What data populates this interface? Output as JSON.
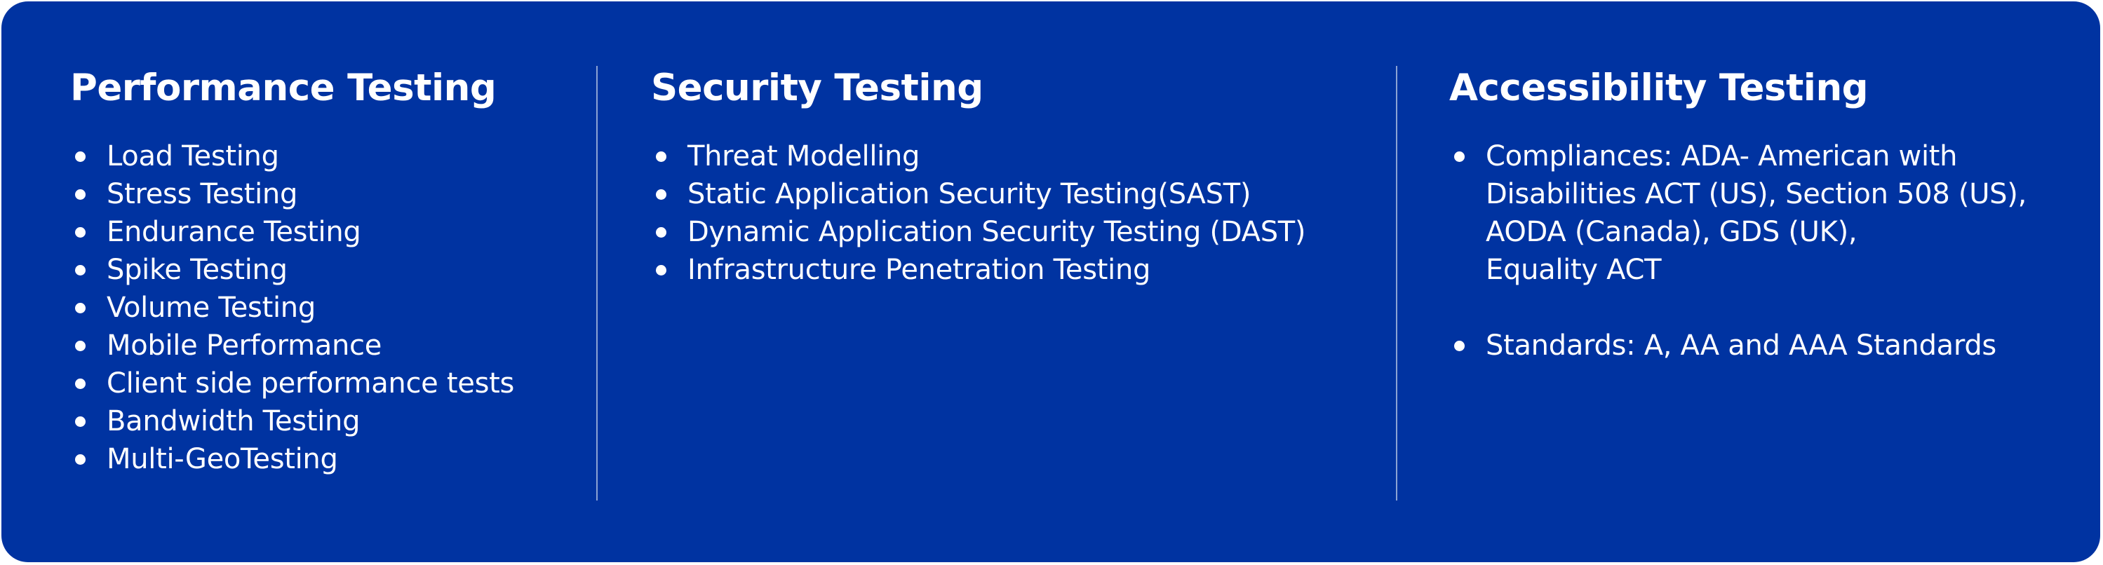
{
  "columns": [
    {
      "title": "Performance Testing",
      "items": [
        "Load Testing",
        "Stress Testing",
        "Endurance Testing",
        "Spike Testing",
        "Volume Testing",
        "Mobile Performance",
        "Client side performance tests",
        "Bandwidth Testing",
        "Multi-GeoTesting"
      ]
    },
    {
      "title": "Security Testing",
      "items": [
        "Threat Modelling",
        "Static Application Security Testing(SAST)",
        "Dynamic Application Security Testing (DAST)",
        "Infrastructure Penetration Testing"
      ]
    },
    {
      "title": "Accessibility Testing",
      "items": [
        {
          "lines": [
            "Compliances:  ADA- American with",
            "Disabilities ACT (US), Section 508 (US),",
            "AODA (Canada), GDS (UK),",
            "Equality ACT"
          ]
        },
        {
          "lines": [
            "Standards: A, AA and AAA Standards"
          ]
        }
      ]
    }
  ],
  "colors": {
    "background": "#0033a1",
    "text": "#ffffff"
  }
}
